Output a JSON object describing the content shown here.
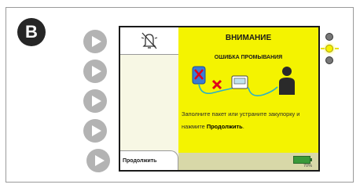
{
  "panel_label": "B",
  "screen": {
    "title": "ВНИМАНИЕ",
    "subtitle": "ОШИБКА ПРОМЫВАНИЯ",
    "message_plain": "Заполните пакет или устраните закупорку и нажмите ",
    "message_bold": "Продолжить",
    "message_end": ".",
    "continue_label": "Продолжить",
    "battery_percent": "70%"
  },
  "side_buttons_count": 5,
  "indicator_leds": [
    {
      "name": "led-top",
      "lit": false
    },
    {
      "name": "led-middle",
      "lit": true
    },
    {
      "name": "led-bottom",
      "lit": false
    }
  ],
  "colors": {
    "alert_yellow": "#f4f300",
    "error_red": "#e0001a",
    "bag_blue": "#3a7bd5",
    "tube": "#2bb0c8"
  }
}
